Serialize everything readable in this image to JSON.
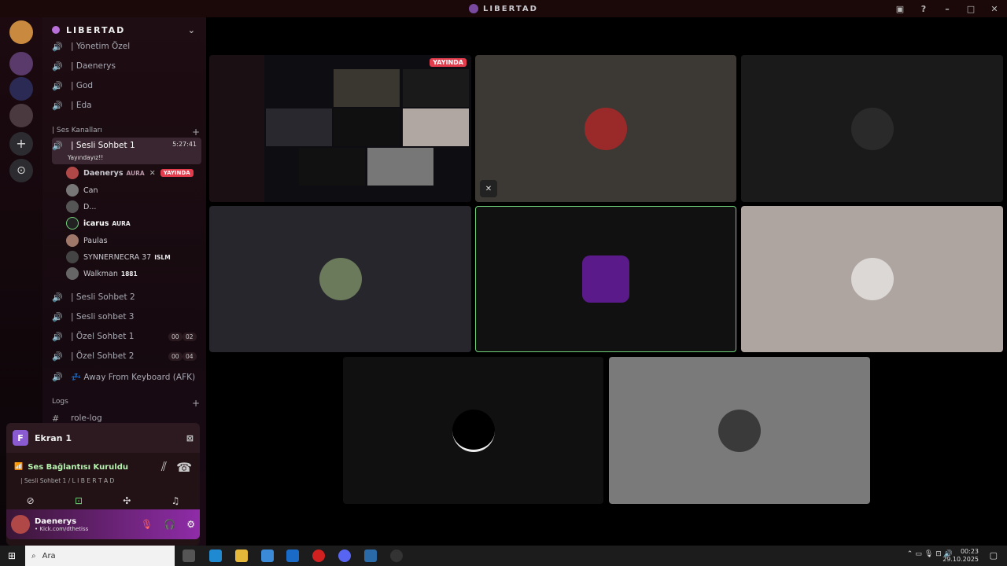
{
  "window": {
    "title": "LIBERTAD"
  },
  "sidebar": {
    "server_name": "LIBERTAD",
    "top_channels": [
      "| Yönetim Özel",
      "| Daenerys",
      "| God",
      "| Eda"
    ],
    "voice_category": "| Ses Kanalları",
    "active_channel": {
      "name": "| Sesli Sohbet 1",
      "timer": "5:27:41",
      "status": "Yayındayız!!"
    },
    "users": [
      {
        "name": "Daenerys",
        "tag": "AURA",
        "badge": "YAYINDA"
      },
      {
        "name": "Can",
        "tag": ""
      },
      {
        "name": "D...",
        "tag": ""
      },
      {
        "name": "icarus",
        "tag": "AURA"
      },
      {
        "name": "Paulas",
        "tag": ""
      },
      {
        "name": "SYNNERNECRA 37",
        "tag": "ISLM"
      },
      {
        "name": "Walkman",
        "tag": "1881"
      }
    ],
    "other_channels": [
      {
        "name": "| Sesli Sohbet 2"
      },
      {
        "name": "| Sesli sohbet 3"
      },
      {
        "name": "| Özel Sohbet 1",
        "count_a": "00",
        "count_b": "02"
      },
      {
        "name": "| Özel Sohbet 2",
        "count_a": "00",
        "count_b": "04"
      },
      {
        "name": "💤 Away From Keyboard (AFK)"
      }
    ],
    "logs_category": "Logs",
    "log_channel": "role-log"
  },
  "screen_share": {
    "label": "Ekran 1",
    "initial": "F"
  },
  "connection": {
    "title": "Ses Bağlantısı Kuruldu",
    "subtitle": "| Sesli Sohbet 1 / L I B E R T A D"
  },
  "user_panel": {
    "name": "Daenerys",
    "status": "• Kick.com/dthetiss"
  },
  "stream": {
    "live_badge": "YAYINDA"
  },
  "taskbar": {
    "search_placeholder": "Ara",
    "time": "00:23",
    "date": "29.10.2025"
  }
}
